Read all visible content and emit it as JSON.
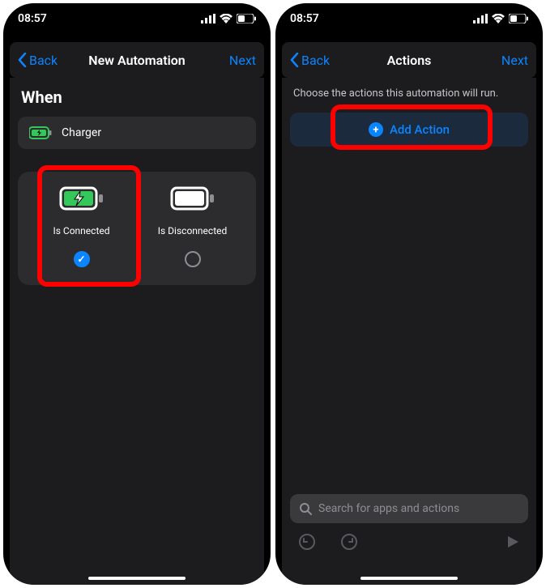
{
  "status": {
    "time": "08:57"
  },
  "left": {
    "nav": {
      "back": "Back",
      "title": "New Automation",
      "next": "Next"
    },
    "section": "When",
    "trigger": "Charger",
    "options": {
      "connected": {
        "label": "Is Connected",
        "selected": true
      },
      "disconnected": {
        "label": "Is Disconnected",
        "selected": false
      }
    }
  },
  "right": {
    "nav": {
      "back": "Back",
      "title": "Actions",
      "next": "Next"
    },
    "subtitle": "Choose the actions this automation will run.",
    "add_action": "Add Action",
    "search_placeholder": "Search for apps and actions"
  }
}
